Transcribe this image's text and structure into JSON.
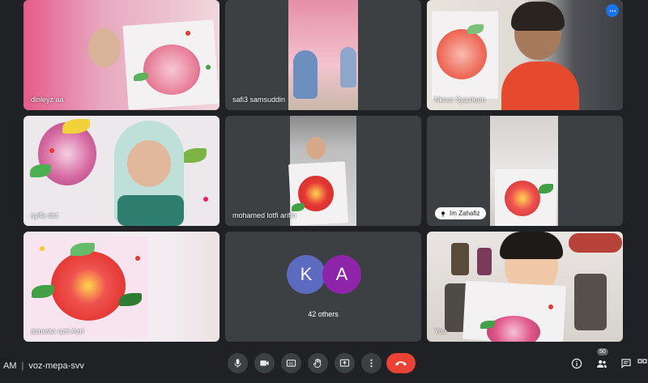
{
  "participants": [
    {
      "name": "dinleyz aa"
    },
    {
      "name": "safi3 samsuddin"
    },
    {
      "name": "Nknur Syazleen"
    },
    {
      "name": "syifa dnt"
    },
    {
      "name": "mohamed lotfi arifin"
    },
    {
      "name": "Im Zahafiz"
    },
    {
      "name": "azuwan azri Azri"
    },
    {
      "name": "You"
    }
  ],
  "others": {
    "avatars": [
      {
        "letter": "K",
        "color": "#5c6bc0"
      },
      {
        "letter": "A",
        "color": "#8e24aa"
      }
    ],
    "label": "42 others"
  },
  "bottom_bar": {
    "time": "AM",
    "separator": "|",
    "meeting_code": "voz-mepa-svv",
    "people_count": "50"
  },
  "colors": {
    "background": "#202124",
    "tile": "#3c4043",
    "active_border": "#8ab4f8",
    "end_call": "#ea4335"
  },
  "icons": [
    "microphone-icon",
    "camera-icon",
    "captions-icon",
    "raise-hand-icon",
    "present-icon",
    "more-options-icon",
    "end-call-icon",
    "info-icon",
    "people-icon",
    "chat-icon",
    "pin-icon"
  ]
}
